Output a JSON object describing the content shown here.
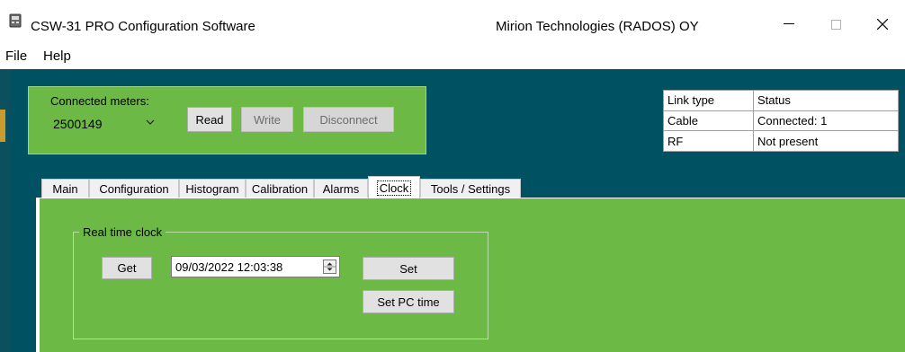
{
  "window": {
    "title": "CSW-31 PRO Configuration Software",
    "company": "Mirion Technologies (RADOS) OY",
    "controls": {
      "minimize": "—",
      "maximize": "☐",
      "close": "✕"
    }
  },
  "menu": {
    "items": [
      "File",
      "Help"
    ]
  },
  "connect": {
    "label": "Connected meters:",
    "selected_meter": "2500149",
    "read_label": "Read",
    "write_label": "Write",
    "disconnect_label": "Disconnect"
  },
  "link_table": {
    "headers": [
      "Link type",
      "Status"
    ],
    "rows": [
      [
        "Cable",
        "Connected: 1"
      ],
      [
        "RF",
        "Not present"
      ]
    ]
  },
  "tabs": [
    "Main",
    "Configuration",
    "Histogram",
    "Calibration",
    "Alarms",
    "Clock",
    "Tools / Settings"
  ],
  "active_tab": "Clock",
  "clock": {
    "group_title": "Real time clock",
    "get_label": "Get",
    "datetime_value": "09/03/2022 12:03:38",
    "set_label": "Set",
    "set_pc_label": "Set PC time"
  },
  "colors": {
    "background": "#005262",
    "panel_green": "#6cba45",
    "button_face": "#e1e1e1"
  }
}
